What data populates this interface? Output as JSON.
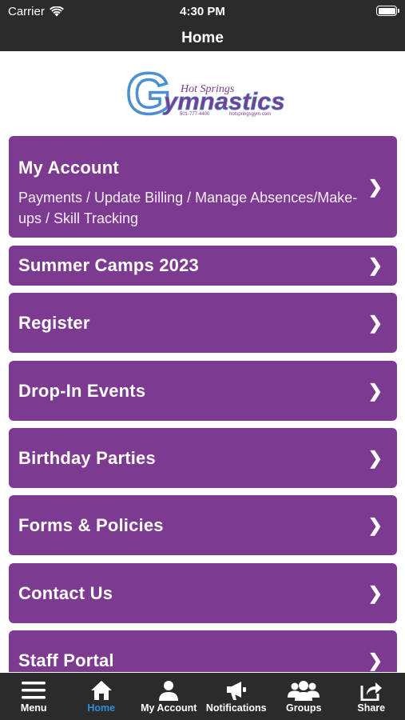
{
  "status_bar": {
    "carrier": "Carrier",
    "time": "4:30 PM"
  },
  "nav": {
    "title": "Home"
  },
  "logo": {
    "big_letter": "G",
    "main_text": "ymnastics",
    "script_text": "Hot Springs",
    "phone": "501-777-4400",
    "website": "hotspringsgym.com"
  },
  "menu": [
    {
      "label": "My Account",
      "subtitle": "Payments / Update Billing / Manage Absences/Make-ups / Skill Tracking"
    },
    {
      "label": "Summer Camps 2023"
    },
    {
      "label": "Register"
    },
    {
      "label": "Drop-In Events"
    },
    {
      "label": "Birthday Parties"
    },
    {
      "label": "Forms & Policies"
    },
    {
      "label": "Contact Us"
    },
    {
      "label": "Staff Portal"
    }
  ],
  "chevron": "❯",
  "tabs": [
    {
      "label": "Menu",
      "icon": "hamburger-icon"
    },
    {
      "label": "Home",
      "icon": "home-icon",
      "active": true
    },
    {
      "label": "My Account",
      "icon": "person-icon"
    },
    {
      "label": "Notifications",
      "icon": "megaphone-icon"
    },
    {
      "label": "Groups",
      "icon": "group-icon"
    },
    {
      "label": "Share",
      "icon": "share-icon"
    }
  ],
  "colors": {
    "bar": "#2b2b2b",
    "menu_item": "#7d3a91",
    "active_tab": "#2f8fd8",
    "logo_blue": "#4a8fd1",
    "logo_purple": "#7d3a91"
  }
}
